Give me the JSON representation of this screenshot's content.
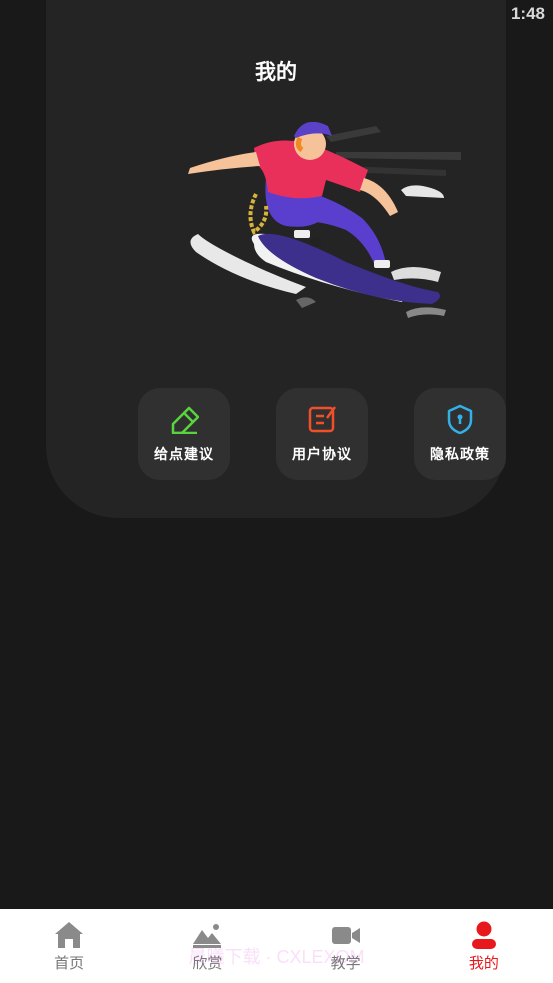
{
  "status_bar": {
    "time": "1:48"
  },
  "page": {
    "title": "我的"
  },
  "actions": [
    {
      "label": "给点建议",
      "icon": "feedback-pen-icon",
      "color": "#58d43e"
    },
    {
      "label": "用户协议",
      "icon": "agreement-edit-icon",
      "color": "#f04f2a"
    },
    {
      "label": "隐私政策",
      "icon": "privacy-shield-icon",
      "color": "#33b0e8"
    }
  ],
  "bottom_nav": {
    "items": [
      {
        "label": "首页",
        "icon": "home-icon"
      },
      {
        "label": "欣赏",
        "icon": "landscape-icon"
      },
      {
        "label": "教学",
        "icon": "video-camera-icon"
      },
      {
        "label": "我的",
        "icon": "person-icon",
        "active": true
      }
    ],
    "active_color": "#e8191c",
    "inactive_color": "#777777"
  },
  "watermark": "晨曦下载 · CXLEXOM"
}
